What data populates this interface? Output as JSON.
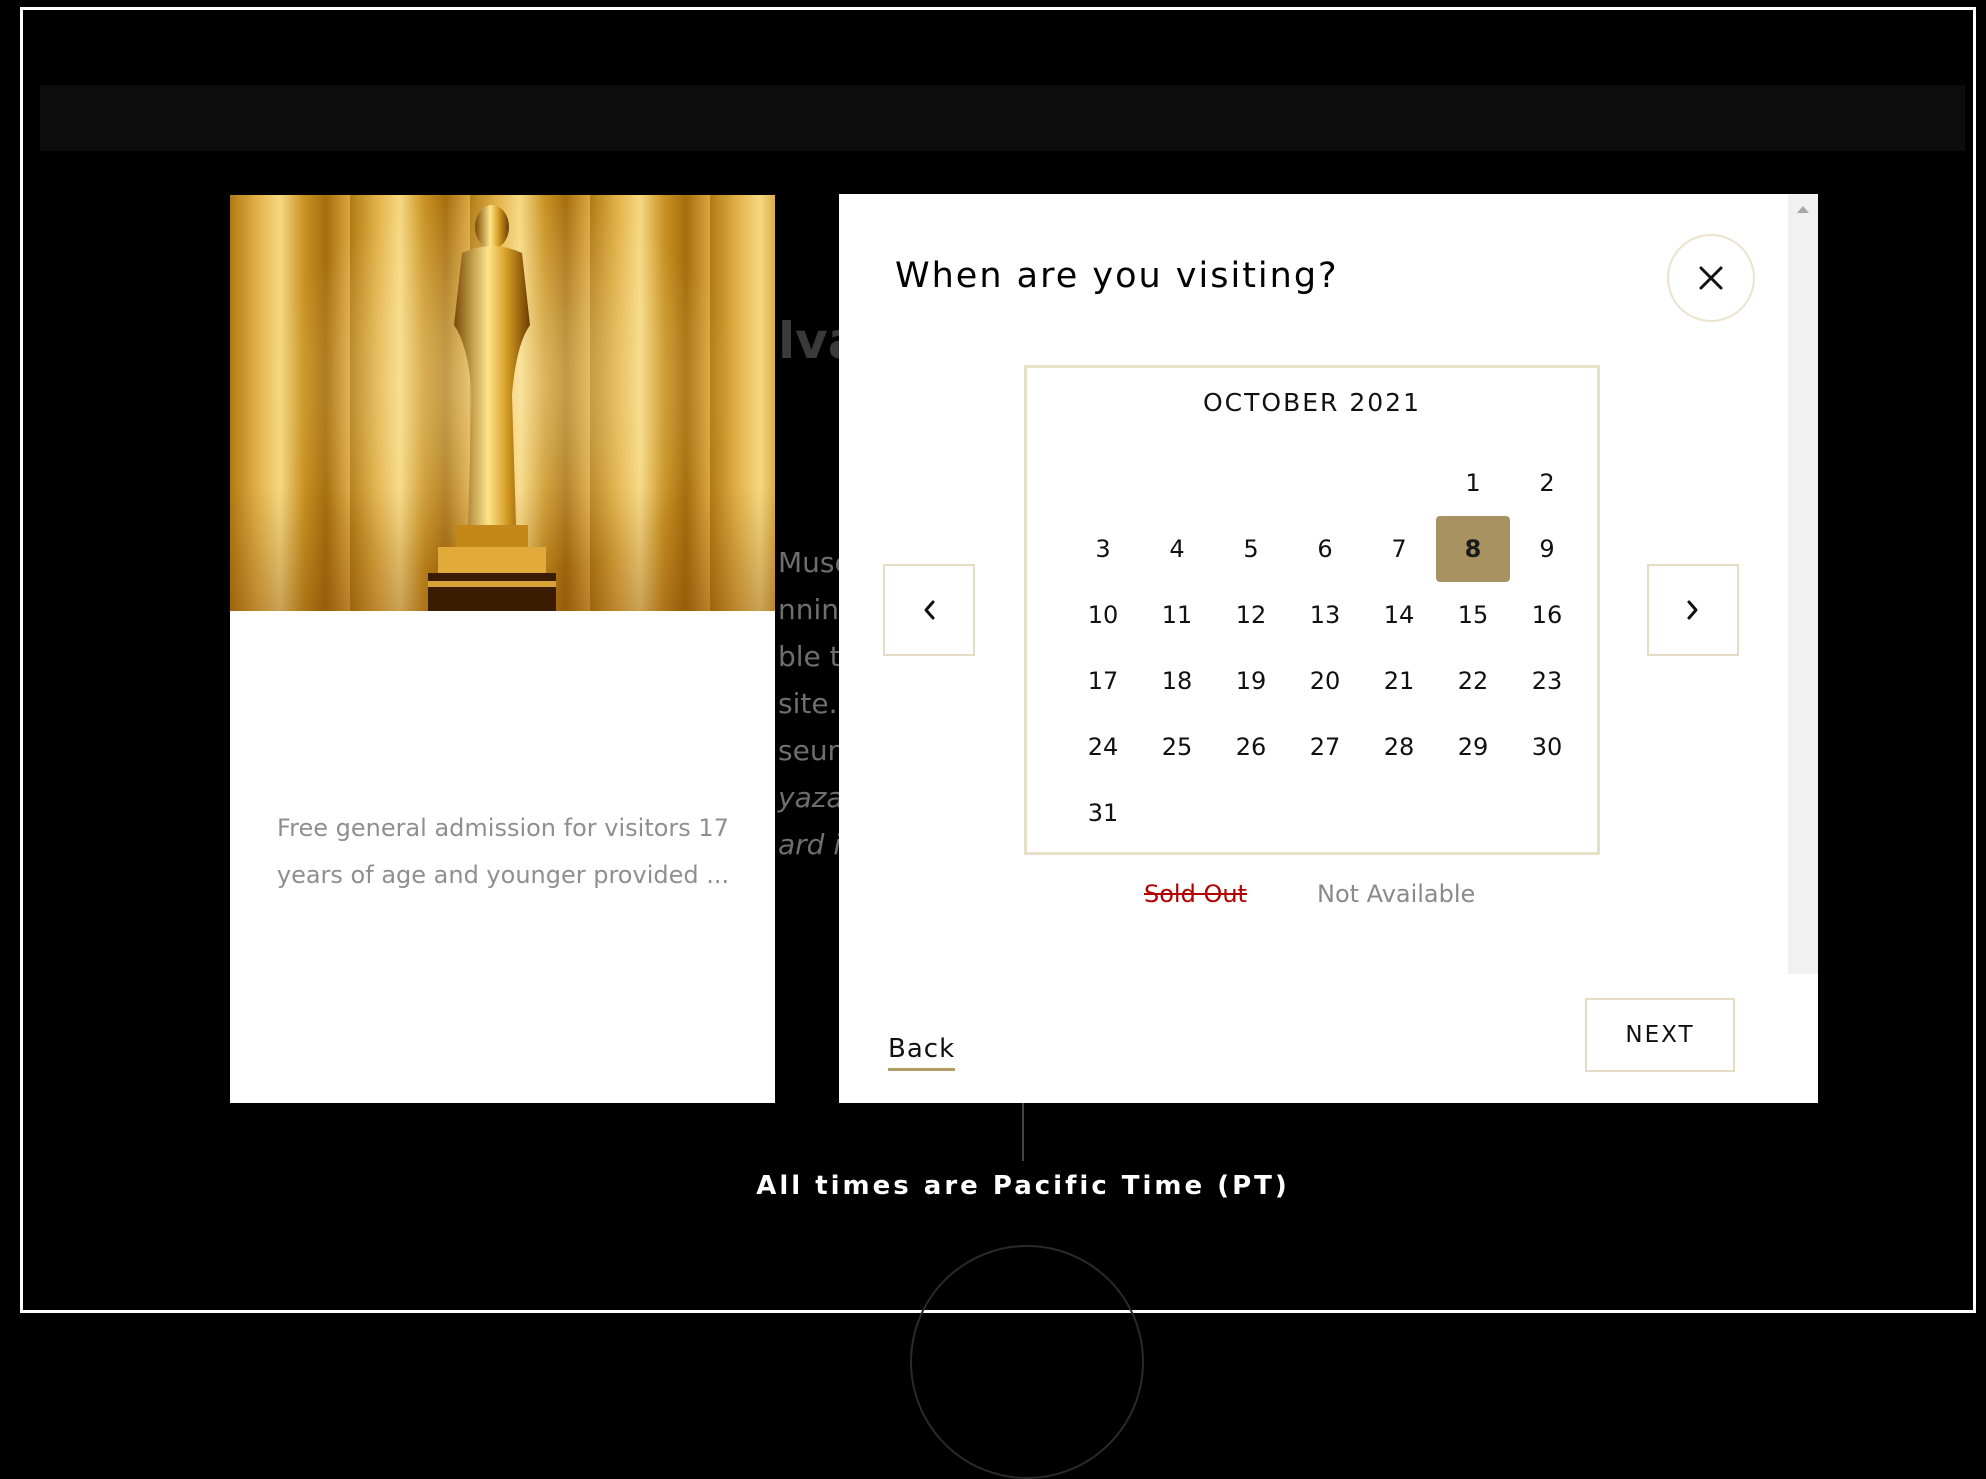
{
  "background": {
    "heading_fragment": "lva",
    "text_fragments": [
      "Muse",
      "nning",
      "ble t",
      "site. A",
      "seum",
      "yazal",
      "ard i"
    ]
  },
  "promo": {
    "image_alt": "Oscar statuette in front of gold curtain",
    "description": "Free general admission for visitors 17 years of age and younger provided ..."
  },
  "modal": {
    "title": "When are you visiting?",
    "close_icon": "close-icon",
    "prev_icon": "chevron-left-icon",
    "next_icon": "chevron-right-icon",
    "calendar": {
      "month": "OCTOBER 2021",
      "leading_blanks": 5,
      "days": [
        "1",
        "2",
        "3",
        "4",
        "5",
        "6",
        "7",
        "8",
        "9",
        "10",
        "11",
        "12",
        "13",
        "14",
        "15",
        "16",
        "17",
        "18",
        "19",
        "20",
        "21",
        "22",
        "23",
        "24",
        "25",
        "26",
        "27",
        "28",
        "29",
        "30",
        "31"
      ],
      "selected_day": "8"
    },
    "legend": {
      "sold_out": "Sold Out",
      "not_available": "Not Available"
    },
    "back_label": "Back",
    "next_label": "NEXT"
  },
  "footer_note": "All times are Pacific Time (PT)",
  "colors": {
    "accent": "#a89262",
    "sold_out": "#b30000",
    "border": "#e6dcc5"
  }
}
